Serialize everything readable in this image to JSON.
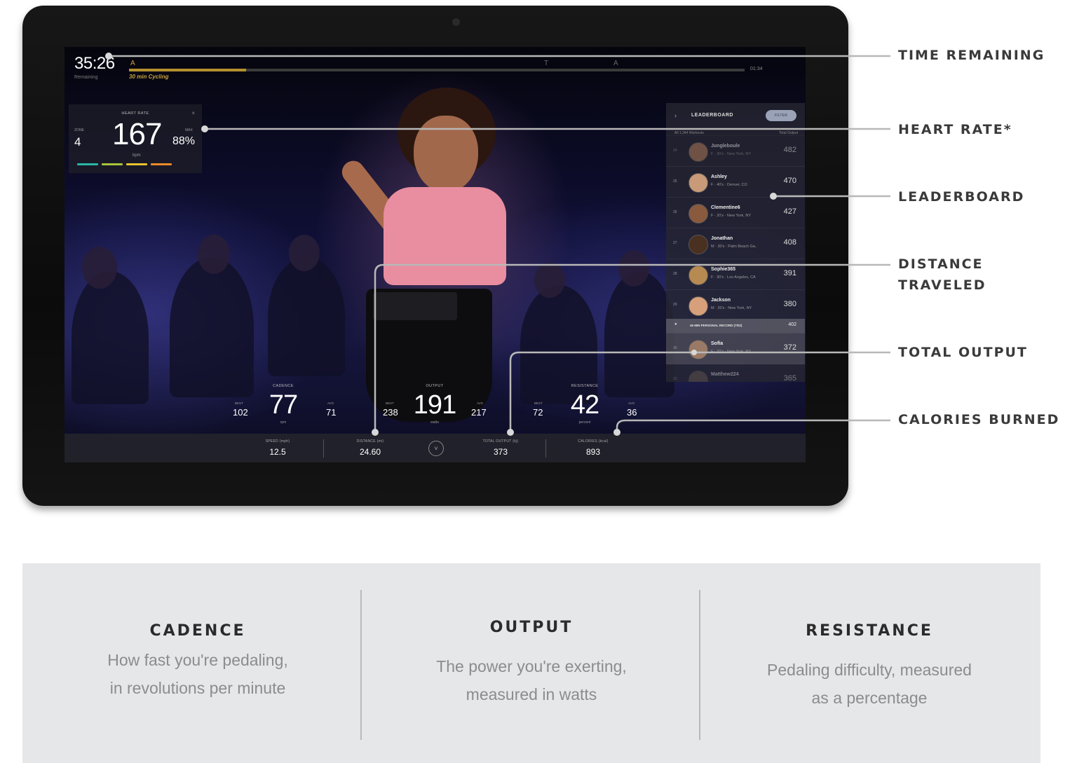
{
  "screen": {
    "time_remaining": "35:26",
    "time_sub": "Remaining",
    "class_name": "30 min Cycling",
    "end_time": "01:34",
    "progress_pct": 0.19,
    "segment_markers": [
      "A",
      "T",
      "A"
    ]
  },
  "heart_rate": {
    "title": "HEART RATE",
    "close": "×",
    "zone_label": "ZONE",
    "zone": "4",
    "value": "167",
    "unit": "bpm",
    "max_label": "MAX",
    "pct_max": "88%",
    "zone_colors": [
      "#2bb5a4",
      "#a8c43a",
      "#e8c22e",
      "#f08a2a"
    ]
  },
  "leaderboard": {
    "title": "LEADERBOARD",
    "filter": "FILTER",
    "sub_left": "All 1,344 Workouts",
    "sub_right": "Total Output",
    "rows": [
      {
        "rank": "24",
        "name": "Jungleboule",
        "loc": "F · 20's · New York, NY",
        "output": "482"
      },
      {
        "rank": "25",
        "name": "Ashley",
        "loc": "F · 40's · Denver, CO",
        "output": "470"
      },
      {
        "rank": "26",
        "name": "Clementine6",
        "loc": "F · 20's · New York, NY",
        "output": "427"
      },
      {
        "rank": "27",
        "name": "Jonathan",
        "loc": "M · 30's · Palm Beach Ga..",
        "output": "408"
      },
      {
        "rank": "28",
        "name": "Sophie365",
        "loc": "F · 30's · Los Angeles, CA",
        "output": "391"
      },
      {
        "rank": "29",
        "name": "Jackson",
        "loc": "M · 20's · New York, NY",
        "output": "380"
      }
    ],
    "pr_text": "45 MIN PERSONAL RECORD (7/02)",
    "pr_value": "402",
    "me": {
      "rank": "30",
      "name": "Sofia",
      "loc": "F · 20's · New York, NY",
      "output": "372"
    },
    "next": {
      "rank": "31",
      "name": "Matthew224",
      "output": "365"
    }
  },
  "metrics": {
    "cadence": {
      "label": "CADENCE",
      "value": "77",
      "unit": "rpm",
      "best_label": "BEST",
      "best": "102",
      "avg_label": "AVG",
      "avg": "71"
    },
    "output": {
      "label": "OUTPUT",
      "value": "191",
      "unit": "watts",
      "best_label": "BEST",
      "best": "238",
      "avg_label": "AVG",
      "avg": "217"
    },
    "resistance": {
      "label": "RESISTANCE",
      "value": "42",
      "unit": "percent",
      "best_label": "BEST",
      "best": "72",
      "avg_label": "AVG",
      "avg": "36"
    }
  },
  "bottom_bar": {
    "speed_label": "SPEED (mph)",
    "speed": "12.5",
    "distance_label": "DISTANCE (mi)",
    "distance": "24.60",
    "output_label": "TOTAL OUTPUT (kj)",
    "total_output": "373",
    "calories_label": "CALORIES (kcal)",
    "calories": "893",
    "toggle": "˅"
  },
  "callouts": {
    "time_remaining": "TIME REMAINING",
    "heart_rate": "HEART RATE*",
    "leaderboard": "LEADERBOARD",
    "distance_line1": "DISTANCE",
    "distance_line2": "TRAVELED",
    "total_output": "TOTAL OUTPUT",
    "calories": "CALORIES BURNED"
  },
  "info": {
    "cadence": {
      "title": "CADENCE",
      "line1": "How fast you're pedaling,",
      "line2": "in revolutions per minute"
    },
    "output": {
      "title": "OUTPUT",
      "line1": "The power you're exerting,",
      "line2": "measured in watts"
    },
    "resistance": {
      "title": "RESISTANCE",
      "line1": "Pedaling difficulty, measured",
      "line2": "as a percentage"
    }
  },
  "colors": {
    "accent_gold": "#c8a33a",
    "callout_line": "#b8b8b8",
    "panel_bg": "#e6e7e9"
  }
}
